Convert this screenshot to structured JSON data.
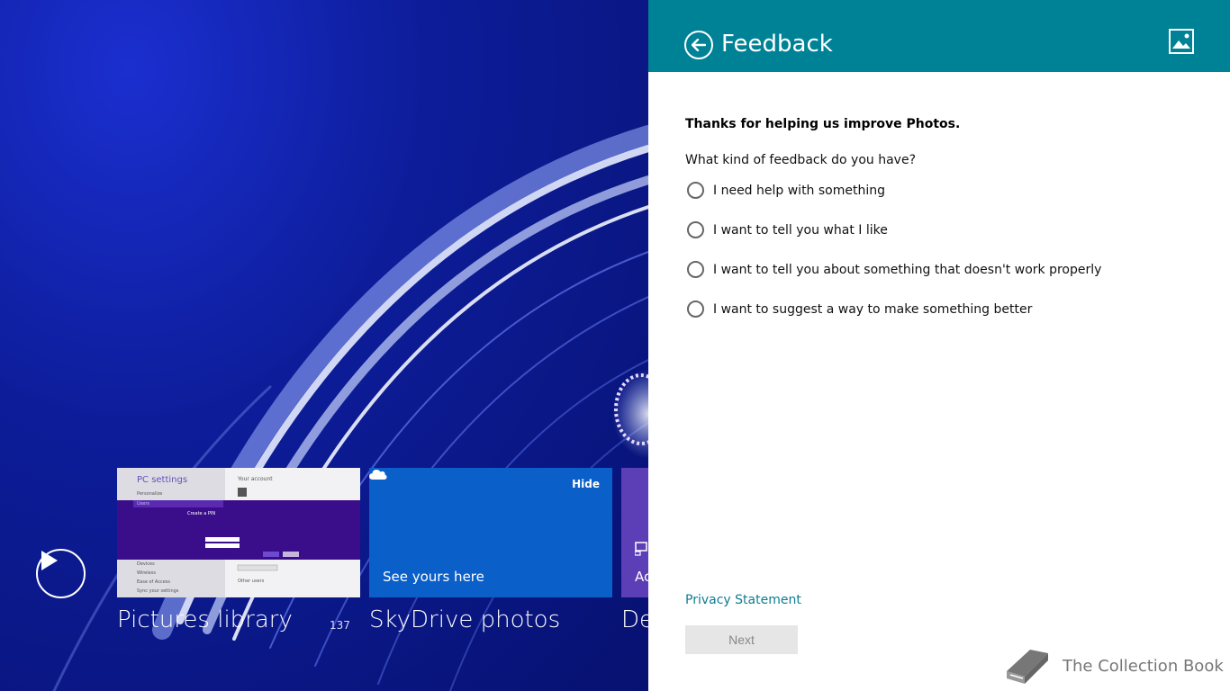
{
  "background": {
    "tiles": [
      {
        "caption": "Pictures library",
        "count": "137"
      },
      {
        "caption": "SkyDrive photos",
        "hide_label": "Hide",
        "body": "See yours here"
      },
      {
        "caption": "De",
        "body": "Ac"
      }
    ],
    "pc_thumb": {
      "title": "PC settings",
      "personalize": "Personalize",
      "users": "Users",
      "your_account": "Your account",
      "create_pin": "Create a PIN",
      "devices": "Devices",
      "wireless": "Wireless",
      "ease": "Ease of Access",
      "sync": "Sync your settings",
      "other_users": "Other users"
    }
  },
  "pane": {
    "title": "Feedback",
    "intro": "Thanks for helping us improve Photos.",
    "question": "What kind of feedback do you have?",
    "options": [
      "I need help with something",
      "I want to tell you what I like",
      "I want to tell you about something that doesn't work properly",
      "I want to suggest a way to make something better"
    ],
    "privacy": "Privacy Statement",
    "next": "Next"
  },
  "watermark": "The Collection Book",
  "colors": {
    "header": "#008296",
    "link": "#0d7d92",
    "tile_blue": "#0a5fc8",
    "tile_purple": "#5c3fb7"
  }
}
